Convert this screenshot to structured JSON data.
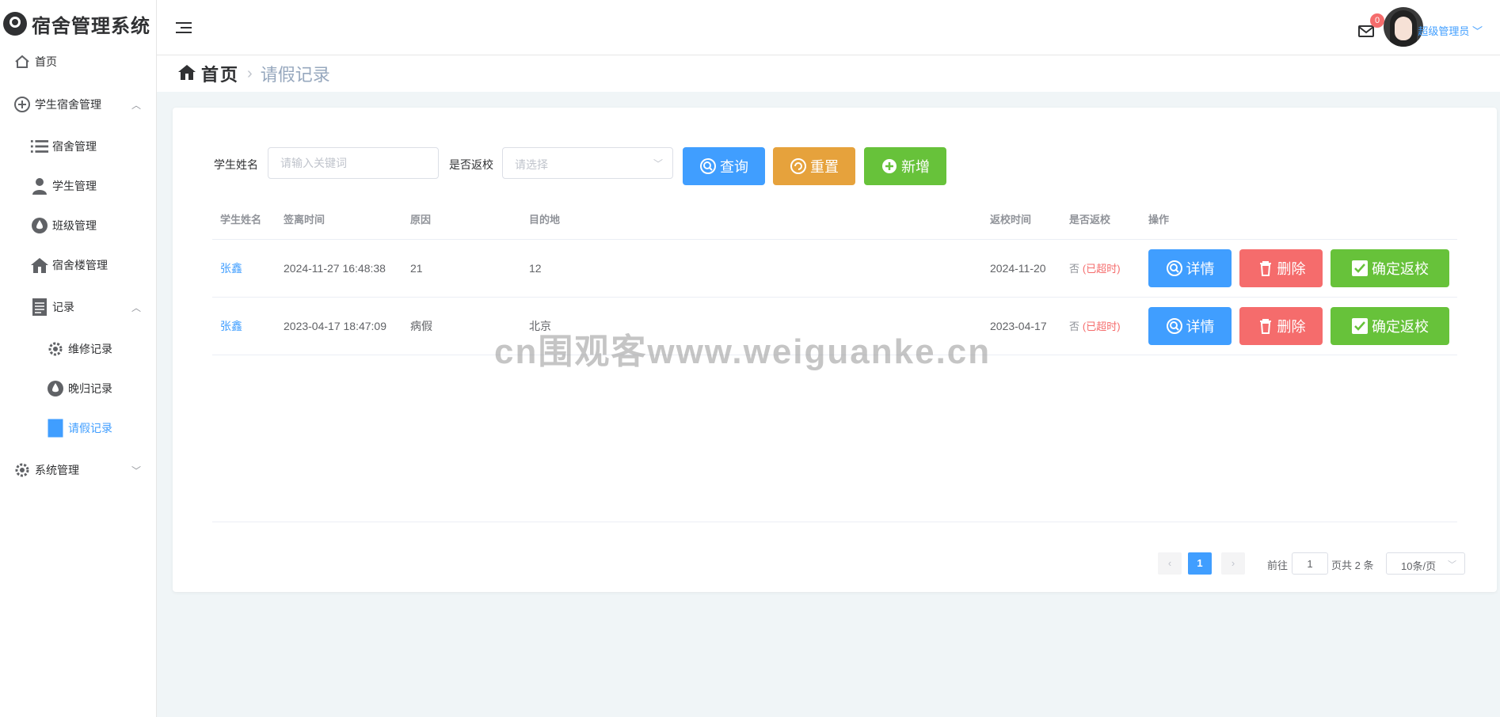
{
  "app": {
    "title": "宿舍管理系统"
  },
  "sidebar": {
    "items": [
      {
        "label": "首页",
        "icon": "home-icon"
      },
      {
        "label": "学生宿舍管理",
        "icon": "plus-circle-icon"
      },
      {
        "label": "宿舍管理",
        "icon": "list-icon"
      },
      {
        "label": "学生管理",
        "icon": "user-icon"
      },
      {
        "label": "班级管理",
        "icon": "drop-icon"
      },
      {
        "label": "宿舍楼管理",
        "icon": "building-icon"
      },
      {
        "label": "记录",
        "icon": "document-icon"
      },
      {
        "label": "维修记录",
        "icon": "gear-icon"
      },
      {
        "label": "晚归记录",
        "icon": "drop-icon"
      },
      {
        "label": "请假记录",
        "icon": "document-icon"
      },
      {
        "label": "系统管理",
        "icon": "gear-icon"
      }
    ]
  },
  "header": {
    "badge_count": "0",
    "user_name": "超级管理员"
  },
  "breadcrumb": {
    "home": "首页",
    "current": "请假记录"
  },
  "search": {
    "name_label": "学生姓名",
    "name_placeholder": "请输入关键词",
    "returned_label": "是否返校",
    "returned_placeholder": "请选择",
    "query_label": "查询",
    "reset_label": "重置",
    "add_label": "新增"
  },
  "table": {
    "headers": [
      "学生姓名",
      "签离时间",
      "原因",
      "目的地",
      "返校时间",
      "是否返校",
      "操作"
    ],
    "rows": [
      {
        "name": "张鑫",
        "leave_time": "2024-11-27 16:48:38",
        "reason": "21",
        "destination": "12",
        "return_time": "2024-11-20",
        "returned": "否",
        "status": "(已超时)"
      },
      {
        "name": "张鑫",
        "leave_time": "2023-04-17 18:47:09",
        "reason": "病假",
        "destination": "北京",
        "return_time": "2023-04-17",
        "returned": "否",
        "status": "(已超时)"
      }
    ],
    "actions": {
      "detail": "详情",
      "delete": "删除",
      "confirm": "确定返校"
    }
  },
  "pagination": {
    "prev": "‹",
    "next": "›",
    "current_page": "1",
    "goto_label": "前往",
    "goto_value": "1",
    "total_text": "页共 2 条",
    "page_size": "10条/页"
  },
  "watermark": "cn围观客www.weiguanke.cn",
  "colors": {
    "primary": "#409eff",
    "warning": "#e6a23c",
    "success": "#67c23a",
    "danger": "#f56c6c"
  }
}
